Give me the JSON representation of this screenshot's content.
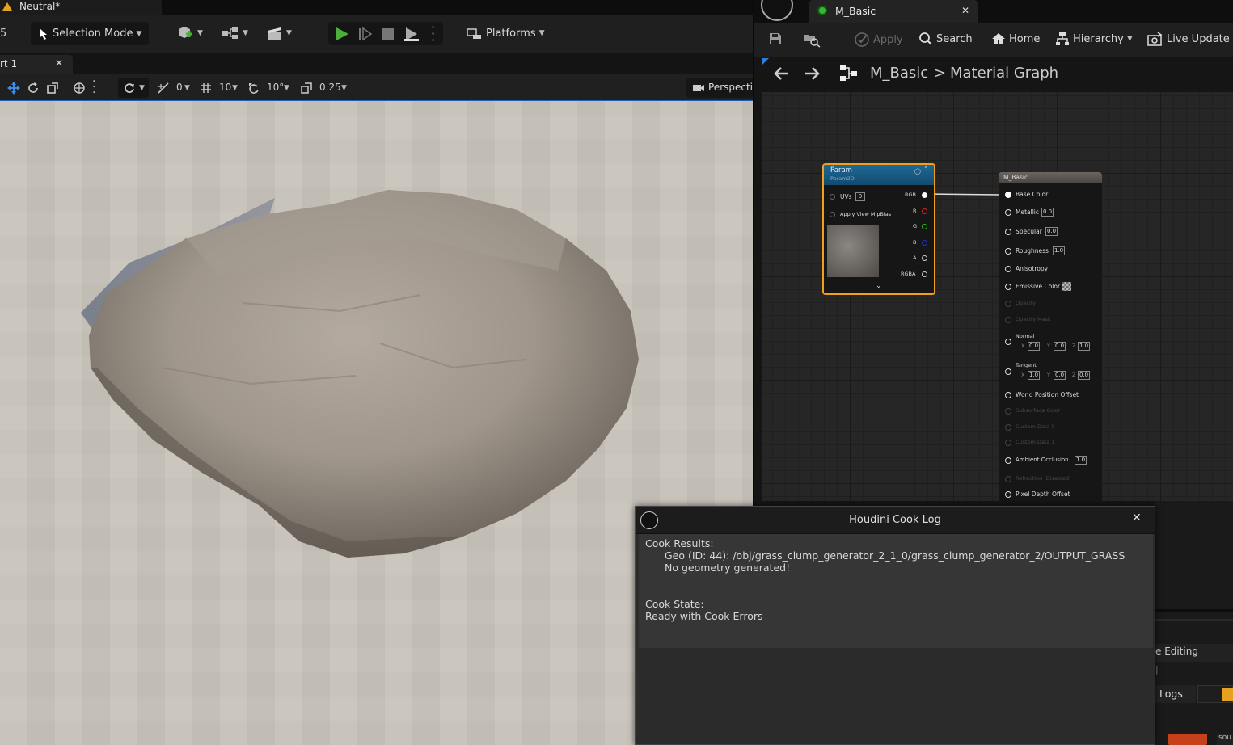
{
  "left_editor": {
    "level_tab": "Neutral*",
    "left_edge_digit": "5",
    "toolbar": {
      "selection_mode": "Selection Mode",
      "platforms": "Platforms"
    },
    "viewport_tab": "rt 1",
    "viewport_toolbar": {
      "rotation_snap": "0",
      "grid_snap": "10",
      "angle_snap": "10°",
      "scale_snap": "0.25",
      "perspective": "Perspecti"
    }
  },
  "material_editor": {
    "tab_title": "M_Basic",
    "toolbar": {
      "apply": "Apply",
      "search": "Search",
      "home": "Home",
      "hierarchy": "Hierarchy",
      "live_update": "Live Update"
    },
    "breadcrumb": {
      "root": "M_Basic",
      "separator": ">",
      "leaf": "Material Graph"
    },
    "param_node": {
      "title": "Param",
      "subtitle": "Param2D",
      "uvs_label": "UVs",
      "uvs_value": "0",
      "mip_label": "Apply View MipBias",
      "outputs": [
        "RGB",
        "R",
        "G",
        "B",
        "A",
        "RGBA"
      ]
    },
    "material_node": {
      "title": "M_Basic",
      "base_color": "Base Color",
      "metallic": "Metallic",
      "metallic_val": "0.0",
      "specular": "Specular",
      "specular_val": "0.0",
      "roughness": "Roughness",
      "roughness_val": "1.0",
      "anisotropy": "Anisotropy",
      "emissive": "Emissive Color",
      "opacity": "Opacity",
      "opacity_mask": "Opacity Mask",
      "normal": "Normal",
      "normal_x": "0.0",
      "normal_y": "0.0",
      "normal_z": "1.0",
      "tangent": "Tangent",
      "tangent_x": "1.0",
      "tangent_y": "0.0",
      "tangent_z": "0.0",
      "x": "X",
      "y": "Y",
      "z": "Z",
      "wpo": "World Position Offset",
      "subsurface": "Subsurface Color",
      "custom0": "Custom Data 0",
      "custom1": "Custom Data 1",
      "ao": "Ambient Occlusion",
      "ao_val": "1.0",
      "refraction": "Refraction (Disabled)",
      "pdo": "Pixel Depth Offset"
    }
  },
  "cook_log": {
    "title": "Houdini Cook Log",
    "close": "✕",
    "results_heading": "Cook Results:",
    "results_geo": "Geo (ID: 44): /obj/grass_clump_generator_2_1_0/grass_clump_generator_2/OUTPUT_GRASS",
    "results_msg": "No geometry generated!",
    "state_heading": "Cook State:",
    "state_value": "Ready with Cook Errors"
  },
  "side_panel": {
    "editing": "e Editing",
    "bar": "|",
    "logs": "Logs",
    "bottom": "sou"
  },
  "colors": {
    "accent_blue": "#1e5fb4",
    "play_green": "#4caf3a",
    "node_highlight": "#f0a020",
    "param_header": "#1a5a82"
  }
}
